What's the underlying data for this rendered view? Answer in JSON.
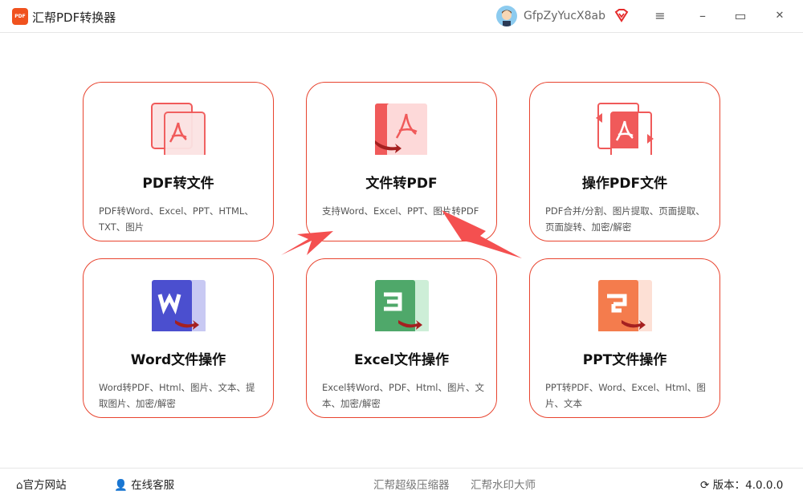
{
  "app": {
    "title": "汇帮PDF转换器",
    "logo_text": "PDF",
    "username": "GfpZyYucX8ab"
  },
  "window_controls": {
    "menu": "≡",
    "minimize": "–",
    "maximize": "▭",
    "close": "✕"
  },
  "cards": [
    {
      "title": "PDF转文件",
      "desc": "PDF转Word、Excel、PPT、HTML、TXT、图片",
      "icon": "pdf-to-file-icon",
      "color": "#f05a5a"
    },
    {
      "title": "文件转PDF",
      "desc": "支持Word、Excel、PPT、图片转PDF",
      "icon": "file-to-pdf-icon",
      "color": "#f05a5a"
    },
    {
      "title": "操作PDF文件",
      "desc": "PDF合并/分割、图片提取、页面提取、页面旋转、加密/解密",
      "icon": "pdf-operations-icon",
      "color": "#f05a5a"
    },
    {
      "title": "Word文件操作",
      "desc": "Word转PDF、Html、图片、文本、提取图片、加密/解密",
      "icon": "word-icon",
      "color": "#4b4fcf"
    },
    {
      "title": "Excel文件操作",
      "desc": "Excel转Word、PDF、Html、图片、文本、加密/解密",
      "icon": "excel-icon",
      "color": "#4fa86a"
    },
    {
      "title": "PPT文件操作",
      "desc": "PPT转PDF、Word、Excel、Html、图片、文本",
      "icon": "ppt-icon",
      "color": "#f47c4d"
    }
  ],
  "footer": {
    "website": "官方网站",
    "support": "在线客服",
    "compressor": "汇帮超级压缩器",
    "watermark": "汇帮水印大师",
    "version": "版本：4.0.0.0"
  },
  "colors": {
    "accent": "#e8442f",
    "arrow": "#f45050"
  }
}
